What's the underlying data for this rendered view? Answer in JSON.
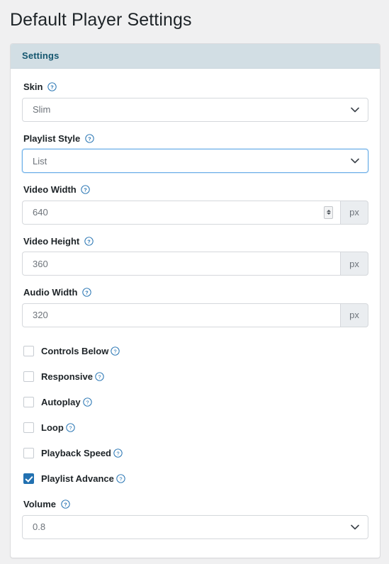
{
  "page": {
    "title": "Default Player Settings",
    "background_color": "#f0f0f1"
  },
  "panel": {
    "header": "Settings",
    "header_bg": "#d2dee4",
    "header_text_color": "#14566f"
  },
  "help_icon_name": "help-circle-icon",
  "accent_color": "#2271b1",
  "fields": {
    "skin": {
      "label": "Skin",
      "value": "Slim",
      "control": "select",
      "focused": false
    },
    "playlist_style": {
      "label": "Playlist Style",
      "value": "List",
      "control": "select",
      "focused": true
    },
    "video_width": {
      "label": "Video Width",
      "value": "640",
      "unit": "px",
      "control": "number",
      "has_spinner": true
    },
    "video_height": {
      "label": "Video Height",
      "value": "360",
      "unit": "px",
      "control": "number",
      "has_spinner": false
    },
    "audio_width": {
      "label": "Audio Width",
      "value": "320",
      "unit": "px",
      "control": "number",
      "has_spinner": false
    },
    "volume": {
      "label": "Volume",
      "value": "0.8",
      "control": "select",
      "focused": false
    }
  },
  "checkboxes": [
    {
      "label": "Controls Below",
      "checked": false
    },
    {
      "label": "Responsive",
      "checked": false
    },
    {
      "label": "Autoplay",
      "checked": false
    },
    {
      "label": "Loop",
      "checked": false
    },
    {
      "label": "Playback Speed",
      "checked": false
    },
    {
      "label": "Playlist Advance",
      "checked": true
    }
  ]
}
